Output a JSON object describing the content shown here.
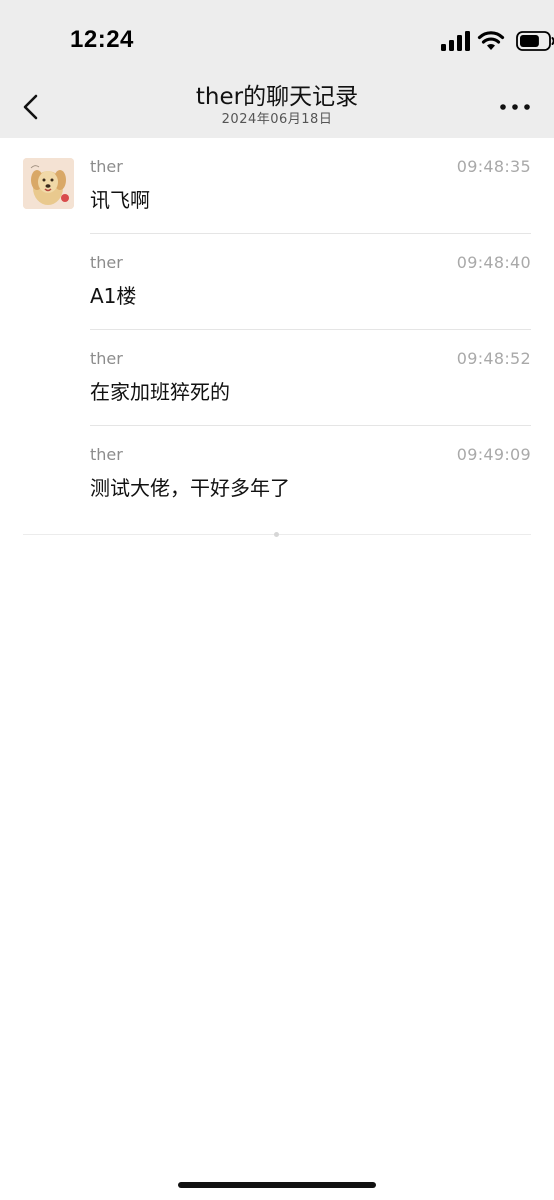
{
  "status_bar": {
    "time": "12:24",
    "signal_icon": "cellular-signal-icon",
    "wifi_icon": "wifi-icon",
    "battery_icon": "battery-icon",
    "battery_level": 0.7
  },
  "nav": {
    "back_icon": "chevron-left-icon",
    "title": "ther的聊天记录",
    "subtitle": "2024年06月18日",
    "more_icon": "more-dots-icon"
  },
  "messages": [
    {
      "sender": "ther",
      "time": "09:48:35",
      "text": "讯飞啊",
      "show_avatar": true
    },
    {
      "sender": "ther",
      "time": "09:48:40",
      "text": "A1楼",
      "show_avatar": false
    },
    {
      "sender": "ther",
      "time": "09:48:52",
      "text": "在家加班猝死的",
      "show_avatar": false
    },
    {
      "sender": "ther",
      "time": "09:49:09",
      "text": "测试大佬，干好多年了",
      "show_avatar": false
    }
  ],
  "colors": {
    "header_bg": "#ededed",
    "sender": "#8c8c8c",
    "timestamp": "#a9a9a9",
    "divider": "#e5e5e5"
  }
}
